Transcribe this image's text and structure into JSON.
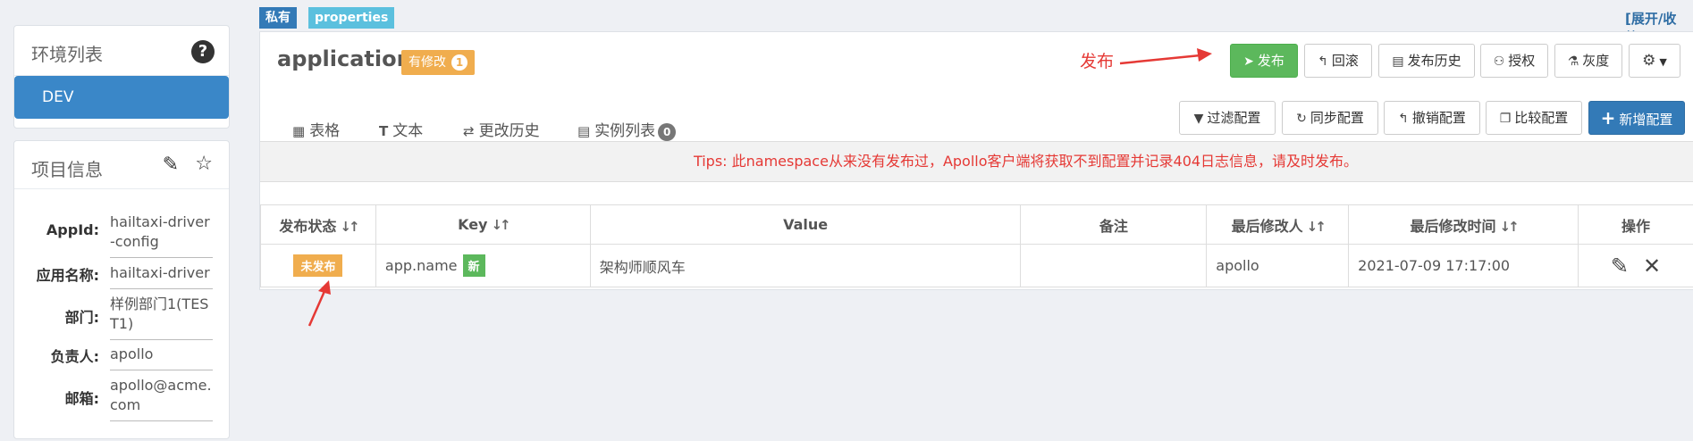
{
  "sidebar": {
    "env_title": "环境列表",
    "env_items": [
      "DEV"
    ],
    "project_title": "项目信息",
    "project": [
      {
        "label": "AppId:",
        "value": "hailtaxi-driver-config"
      },
      {
        "label": "应用名称:",
        "value": "hailtaxi-driver"
      },
      {
        "label": "部门:",
        "value": "样例部门1(TEST1)"
      },
      {
        "label": "负责人:",
        "value": "apollo"
      },
      {
        "label": "邮箱:",
        "value": "apollo@acme.com"
      }
    ]
  },
  "tags": {
    "private": "私有",
    "properties": "properties"
  },
  "expand_link": "[展开/收缩]",
  "namespace": {
    "title": "application",
    "modified_label": "有修改",
    "modified_count": "1"
  },
  "annotation": "发布",
  "toolbar": {
    "publish": "发布",
    "rollback": "回滚",
    "history": "发布历史",
    "grant": "授权",
    "gray": "灰度",
    "settings_icon": "gear-icon"
  },
  "tabs": [
    {
      "label": "表格"
    },
    {
      "label": "文本"
    },
    {
      "label": "更改历史"
    },
    {
      "label": "实例列表",
      "count": "0"
    }
  ],
  "actions": {
    "filter": "过滤配置",
    "sync": "同步配置",
    "revoke": "撤销配置",
    "compare": "比较配置",
    "add": "新增配置"
  },
  "tips": "Tips: 此namespace从来没有发布过，Apollo客户端将获取不到配置并记录404日志信息，请及时发布。",
  "table": {
    "headers": [
      "发布状态",
      "Key",
      "Value",
      "备注",
      "最后修改人",
      "最后修改时间",
      "操作"
    ],
    "rows": [
      {
        "status": "未发布",
        "key": "app.name",
        "new_badge": "新",
        "value": "架构师顺风车",
        "comment": "",
        "modifier": "apollo",
        "time": "2021-07-09 17:17:00"
      }
    ]
  },
  "colors": {
    "accent": "#337ab7",
    "publish": "#5cb85c",
    "warning": "#f0ad4e",
    "danger": "#e53935"
  }
}
